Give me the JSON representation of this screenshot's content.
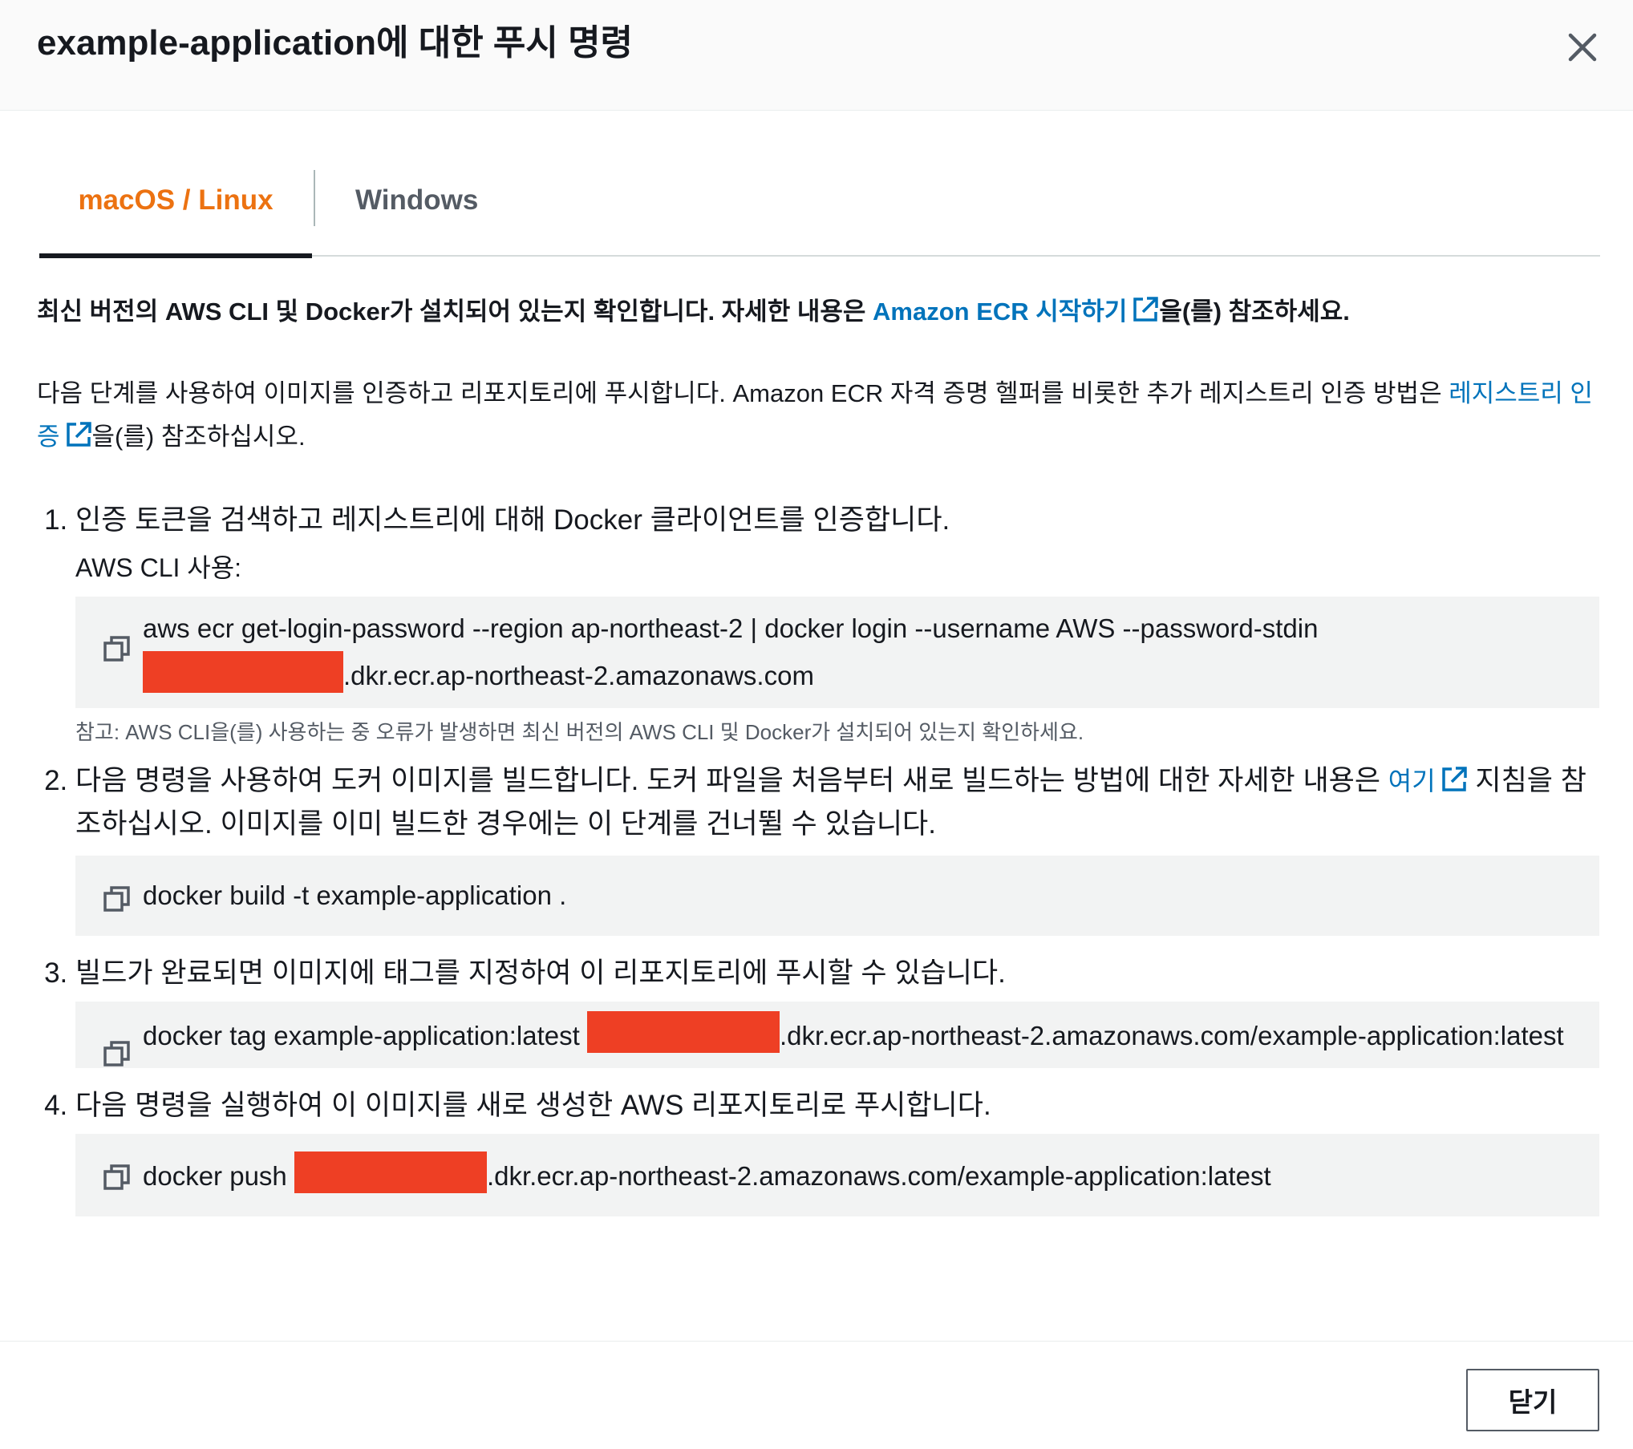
{
  "modal": {
    "title": "example-application에 대한 푸시 명령",
    "close_icon": "close-icon"
  },
  "tabs": [
    {
      "label": "macOS / Linux",
      "active": true
    },
    {
      "label": "Windows",
      "active": false
    }
  ],
  "intro": {
    "lead_prefix": "최신 버전의 AWS CLI 및 Docker가 설치되어 있는지 확인합니다. 자세한 내용은 ",
    "lead_link": "Amazon ECR 시작하기",
    "lead_suffix": "을(를) 참조하세요.",
    "para_prefix": "다음 단계를 사용하여 이미지를 인증하고 리포지토리에 푸시합니다. Amazon ECR 자격 증명 헬퍼를 비롯한 추가 레지스트리 인증 방법은 ",
    "para_link": "레지스트리 인증",
    "para_suffix": "을(를) 참조하십시오."
  },
  "steps": [
    {
      "text": "인증 토큰을 검색하고 레지스트리에 대해 Docker 클라이언트를 인증합니다.",
      "sub": "AWS CLI 사용:",
      "code_part1": "aws ecr get-login-password --region ap-northeast-2 | docker login --username AWS --password-stdin",
      "code_part2": ".dkr.ecr.ap-northeast-2.amazonaws.com",
      "note": "참고: AWS CLI을(를) 사용하는 중 오류가 발생하면 최신 버전의 AWS CLI 및 Docker가 설치되어 있는지 확인하세요."
    },
    {
      "text_prefix": "다음 명령을 사용하여 도커 이미지를 빌드합니다. 도커 파일을 처음부터 새로 빌드하는 방법에 대한 자세한 내용은 ",
      "link": "여기",
      "text_suffix": " 지침을 참조하십시오. 이미지를 이미 빌드한 경우에는 이 단계를 건너뛸 수 있습니다.",
      "code": "docker build -t example-application ."
    },
    {
      "text": "빌드가 완료되면 이미지에 태그를 지정하여 이 리포지토리에 푸시할 수 있습니다.",
      "code_part1": "docker tag example-application:latest",
      "code_part2": ".dkr.ecr.ap-northeast-2.amazonaws.com/example-application:latest"
    },
    {
      "text": "다음 명령을 실행하여 이 이미지를 새로 생성한 AWS 리포지토리로 푸시합니다.",
      "code_part1": "docker push",
      "code_part2": ".dkr.ecr.ap-northeast-2.amazonaws.com/example-application:latest"
    }
  ],
  "footer": {
    "close_label": "닫기"
  },
  "colors": {
    "accent": "#ec7211",
    "link": "#0073bb",
    "redaction": "#ee3f24",
    "code_bg": "#f2f3f3"
  }
}
